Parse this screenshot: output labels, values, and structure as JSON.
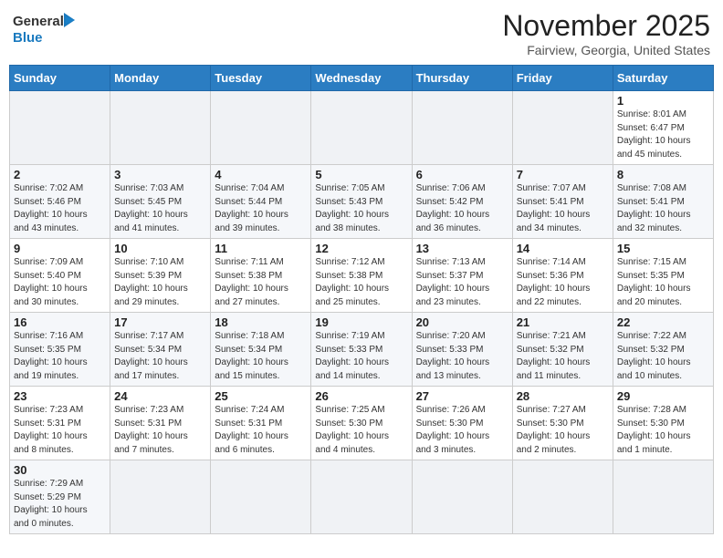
{
  "header": {
    "logo_general": "General",
    "logo_blue": "Blue",
    "month_title": "November 2025",
    "subtitle": "Fairview, Georgia, United States"
  },
  "days_of_week": [
    "Sunday",
    "Monday",
    "Tuesday",
    "Wednesday",
    "Thursday",
    "Friday",
    "Saturday"
  ],
  "weeks": [
    [
      {
        "day": "",
        "info": ""
      },
      {
        "day": "",
        "info": ""
      },
      {
        "day": "",
        "info": ""
      },
      {
        "day": "",
        "info": ""
      },
      {
        "day": "",
        "info": ""
      },
      {
        "day": "",
        "info": ""
      },
      {
        "day": "1",
        "info": "Sunrise: 8:01 AM\nSunset: 6:47 PM\nDaylight: 10 hours\nand 45 minutes."
      }
    ],
    [
      {
        "day": "2",
        "info": "Sunrise: 7:02 AM\nSunset: 5:46 PM\nDaylight: 10 hours\nand 43 minutes."
      },
      {
        "day": "3",
        "info": "Sunrise: 7:03 AM\nSunset: 5:45 PM\nDaylight: 10 hours\nand 41 minutes."
      },
      {
        "day": "4",
        "info": "Sunrise: 7:04 AM\nSunset: 5:44 PM\nDaylight: 10 hours\nand 39 minutes."
      },
      {
        "day": "5",
        "info": "Sunrise: 7:05 AM\nSunset: 5:43 PM\nDaylight: 10 hours\nand 38 minutes."
      },
      {
        "day": "6",
        "info": "Sunrise: 7:06 AM\nSunset: 5:42 PM\nDaylight: 10 hours\nand 36 minutes."
      },
      {
        "day": "7",
        "info": "Sunrise: 7:07 AM\nSunset: 5:41 PM\nDaylight: 10 hours\nand 34 minutes."
      },
      {
        "day": "8",
        "info": "Sunrise: 7:08 AM\nSunset: 5:41 PM\nDaylight: 10 hours\nand 32 minutes."
      }
    ],
    [
      {
        "day": "9",
        "info": "Sunrise: 7:09 AM\nSunset: 5:40 PM\nDaylight: 10 hours\nand 30 minutes."
      },
      {
        "day": "10",
        "info": "Sunrise: 7:10 AM\nSunset: 5:39 PM\nDaylight: 10 hours\nand 29 minutes."
      },
      {
        "day": "11",
        "info": "Sunrise: 7:11 AM\nSunset: 5:38 PM\nDaylight: 10 hours\nand 27 minutes."
      },
      {
        "day": "12",
        "info": "Sunrise: 7:12 AM\nSunset: 5:38 PM\nDaylight: 10 hours\nand 25 minutes."
      },
      {
        "day": "13",
        "info": "Sunrise: 7:13 AM\nSunset: 5:37 PM\nDaylight: 10 hours\nand 23 minutes."
      },
      {
        "day": "14",
        "info": "Sunrise: 7:14 AM\nSunset: 5:36 PM\nDaylight: 10 hours\nand 22 minutes."
      },
      {
        "day": "15",
        "info": "Sunrise: 7:15 AM\nSunset: 5:35 PM\nDaylight: 10 hours\nand 20 minutes."
      }
    ],
    [
      {
        "day": "16",
        "info": "Sunrise: 7:16 AM\nSunset: 5:35 PM\nDaylight: 10 hours\nand 19 minutes."
      },
      {
        "day": "17",
        "info": "Sunrise: 7:17 AM\nSunset: 5:34 PM\nDaylight: 10 hours\nand 17 minutes."
      },
      {
        "day": "18",
        "info": "Sunrise: 7:18 AM\nSunset: 5:34 PM\nDaylight: 10 hours\nand 15 minutes."
      },
      {
        "day": "19",
        "info": "Sunrise: 7:19 AM\nSunset: 5:33 PM\nDaylight: 10 hours\nand 14 minutes."
      },
      {
        "day": "20",
        "info": "Sunrise: 7:20 AM\nSunset: 5:33 PM\nDaylight: 10 hours\nand 13 minutes."
      },
      {
        "day": "21",
        "info": "Sunrise: 7:21 AM\nSunset: 5:32 PM\nDaylight: 10 hours\nand 11 minutes."
      },
      {
        "day": "22",
        "info": "Sunrise: 7:22 AM\nSunset: 5:32 PM\nDaylight: 10 hours\nand 10 minutes."
      }
    ],
    [
      {
        "day": "23",
        "info": "Sunrise: 7:23 AM\nSunset: 5:31 PM\nDaylight: 10 hours\nand 8 minutes."
      },
      {
        "day": "24",
        "info": "Sunrise: 7:23 AM\nSunset: 5:31 PM\nDaylight: 10 hours\nand 7 minutes."
      },
      {
        "day": "25",
        "info": "Sunrise: 7:24 AM\nSunset: 5:31 PM\nDaylight: 10 hours\nand 6 minutes."
      },
      {
        "day": "26",
        "info": "Sunrise: 7:25 AM\nSunset: 5:30 PM\nDaylight: 10 hours\nand 4 minutes."
      },
      {
        "day": "27",
        "info": "Sunrise: 7:26 AM\nSunset: 5:30 PM\nDaylight: 10 hours\nand 3 minutes."
      },
      {
        "day": "28",
        "info": "Sunrise: 7:27 AM\nSunset: 5:30 PM\nDaylight: 10 hours\nand 2 minutes."
      },
      {
        "day": "29",
        "info": "Sunrise: 7:28 AM\nSunset: 5:30 PM\nDaylight: 10 hours\nand 1 minute."
      }
    ],
    [
      {
        "day": "30",
        "info": "Sunrise: 7:29 AM\nSunset: 5:29 PM\nDaylight: 10 hours\nand 0 minutes."
      },
      {
        "day": "",
        "info": ""
      },
      {
        "day": "",
        "info": ""
      },
      {
        "day": "",
        "info": ""
      },
      {
        "day": "",
        "info": ""
      },
      {
        "day": "",
        "info": ""
      },
      {
        "day": "",
        "info": ""
      }
    ]
  ]
}
